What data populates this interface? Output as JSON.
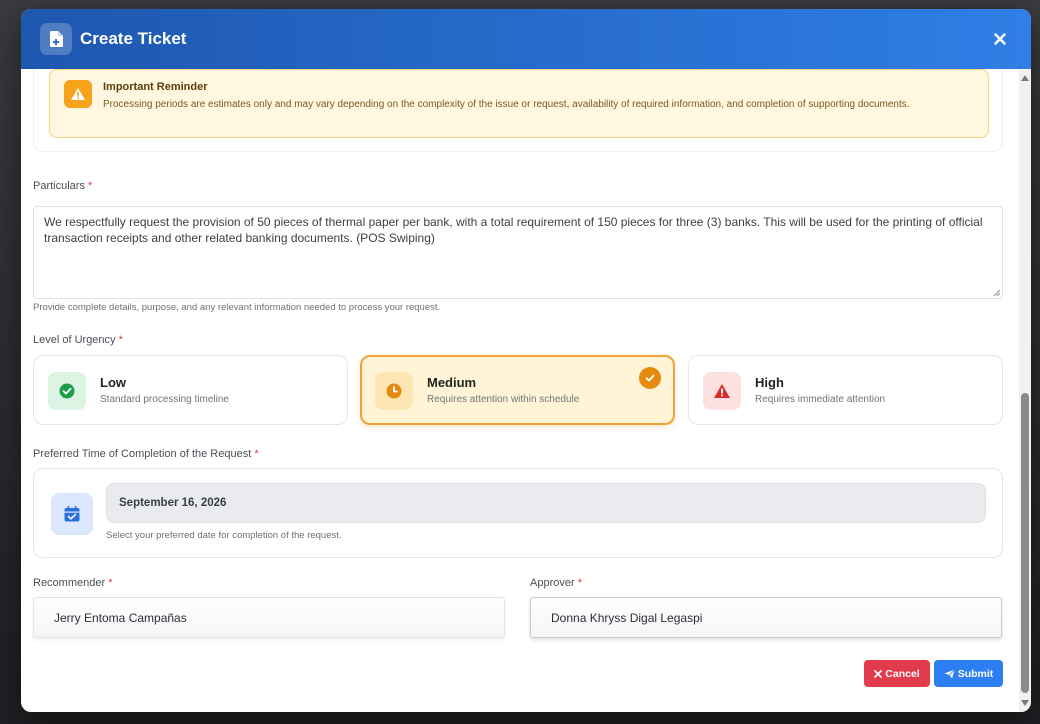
{
  "modal": {
    "title": "Create Ticket",
    "header_color": "#2f7fe6"
  },
  "reminder": {
    "title": "Important Reminder",
    "text": "Processing periods are estimates only and may vary depending on the complexity of the issue or request, availability of required information, and completion of supporting documents.",
    "icon": "warning-icon"
  },
  "particulars": {
    "label": "Particulars",
    "required_mark": "*",
    "value": "We respectfully request the provision of 50 pieces of thermal paper per bank, with a total requirement of 150 pieces for three (3) banks. This will be used for the printing of official transaction receipts and other related banking documents. (POS Swiping)",
    "help": "Provide complete details, purpose, and any relevant information needed to process your request."
  },
  "urgency": {
    "label": "Level of Urgency",
    "required_mark": "*",
    "selected": "Medium",
    "options": [
      {
        "title": "Low",
        "desc": "Standard processing timeline",
        "icon": "check-circle-icon",
        "color": "#1e9e4a"
      },
      {
        "title": "Medium",
        "desc": "Requires attention within schedule",
        "icon": "clock-icon",
        "color": "#e48a0e"
      },
      {
        "title": "High",
        "desc": "Requires immediate attention",
        "icon": "warning-icon",
        "color": "#d92b2b"
      }
    ]
  },
  "completion": {
    "label": "Preferred Time of Completion of the Request",
    "required_mark": "*",
    "value": "September 16, 2026",
    "help": "Select your preferred date for completion of the request.",
    "icon": "calendar-check-icon"
  },
  "recommender": {
    "label": "Recommender",
    "required_mark": "*",
    "value": "Jerry Entoma Campañas"
  },
  "approver": {
    "label": "Approver",
    "required_mark": "*",
    "value": "Donna Khryss Digal Legaspi"
  },
  "actions": {
    "cancel_label": "Cancel",
    "submit_label": "Submit",
    "cancel_color": "#e23b4c",
    "submit_color": "#2b7ff0"
  }
}
